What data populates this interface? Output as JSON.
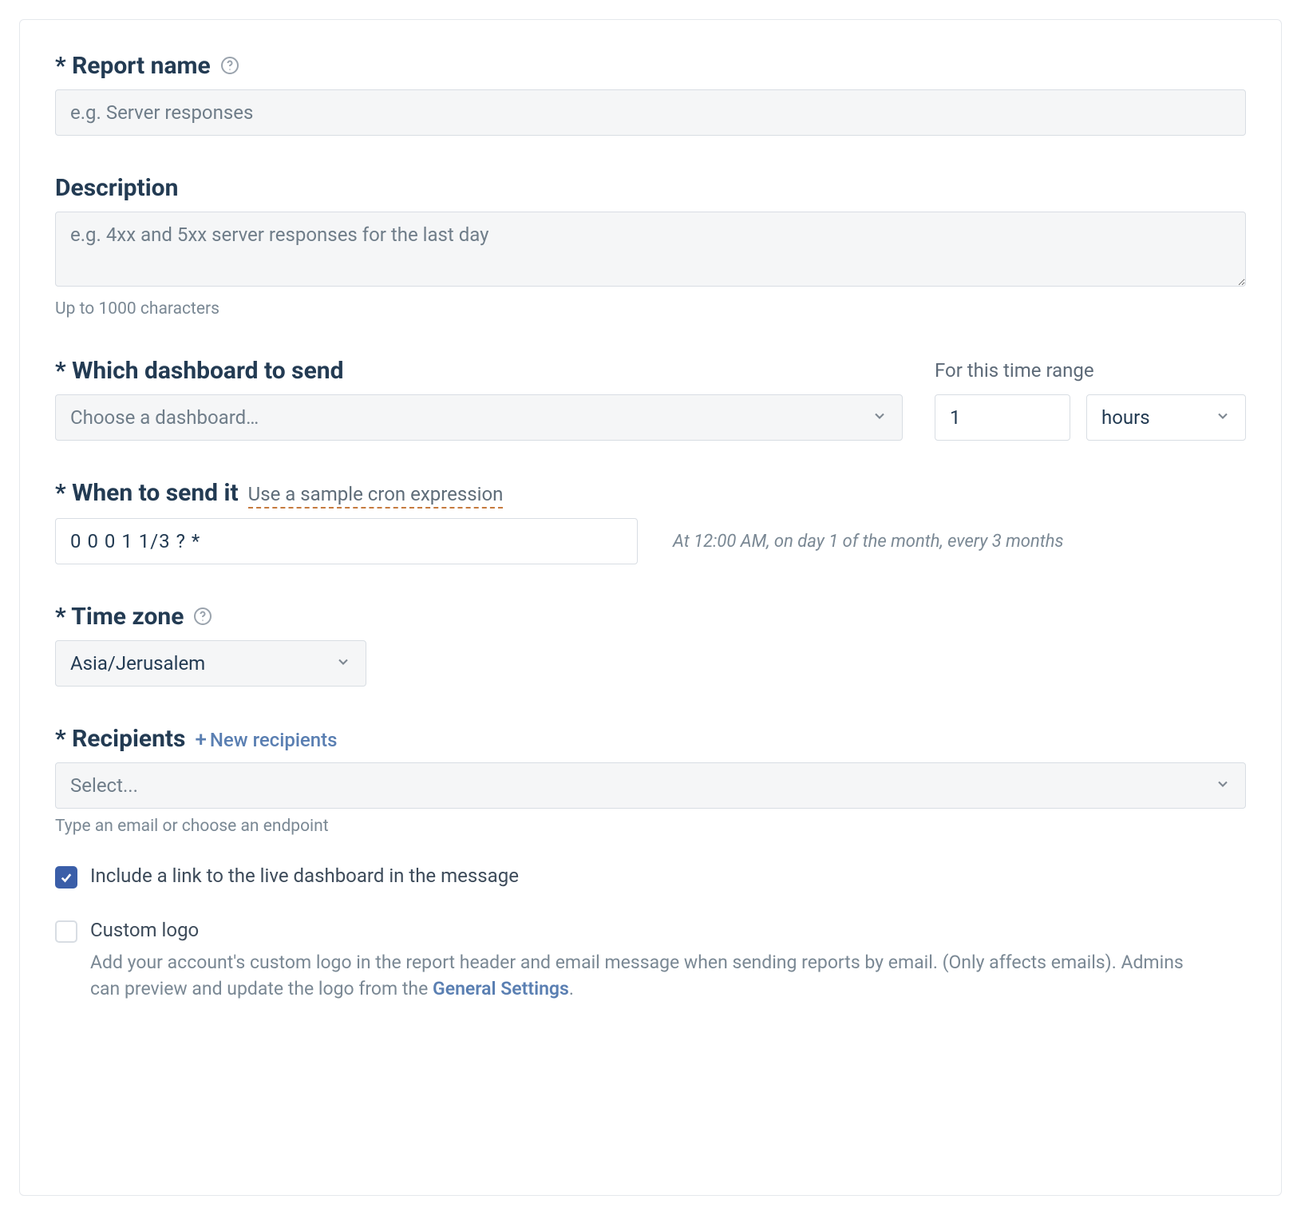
{
  "reportName": {
    "label": "* Report name",
    "placeholder": "e.g. Server responses",
    "value": ""
  },
  "description": {
    "label": "Description",
    "placeholder": "e.g. 4xx and 5xx server responses for the last day",
    "value": "",
    "hint": "Up to 1000 characters"
  },
  "dashboard": {
    "label": "* Which dashboard to send",
    "placeholder": "Choose a dashboard…",
    "timeRangeLabel": "For this time range",
    "timeValue": "1",
    "timeUnit": "hours"
  },
  "schedule": {
    "label": "* When to send it",
    "sampleLink": "Use a sample cron expression",
    "cronValue": "0 0 0 1 1/3 ? *",
    "cronDescription": "At 12:00 AM, on day 1 of the month, every 3 months"
  },
  "timezone": {
    "label": "* Time zone",
    "value": "Asia/Jerusalem"
  },
  "recipients": {
    "label": "* Recipients",
    "newLink": "New recipients",
    "placeholder": "Select...",
    "hint": "Type an email or choose an endpoint"
  },
  "includeLink": {
    "checked": true,
    "label": "Include a link to the live dashboard in the message"
  },
  "customLogo": {
    "checked": false,
    "label": "Custom logo",
    "descriptionPrefix": "Add your account's custom logo in the report header and email message when sending reports by email. (Only affects emails). Admins can preview and update the logo from the ",
    "linkText": "General Settings",
    "descriptionSuffix": "."
  }
}
